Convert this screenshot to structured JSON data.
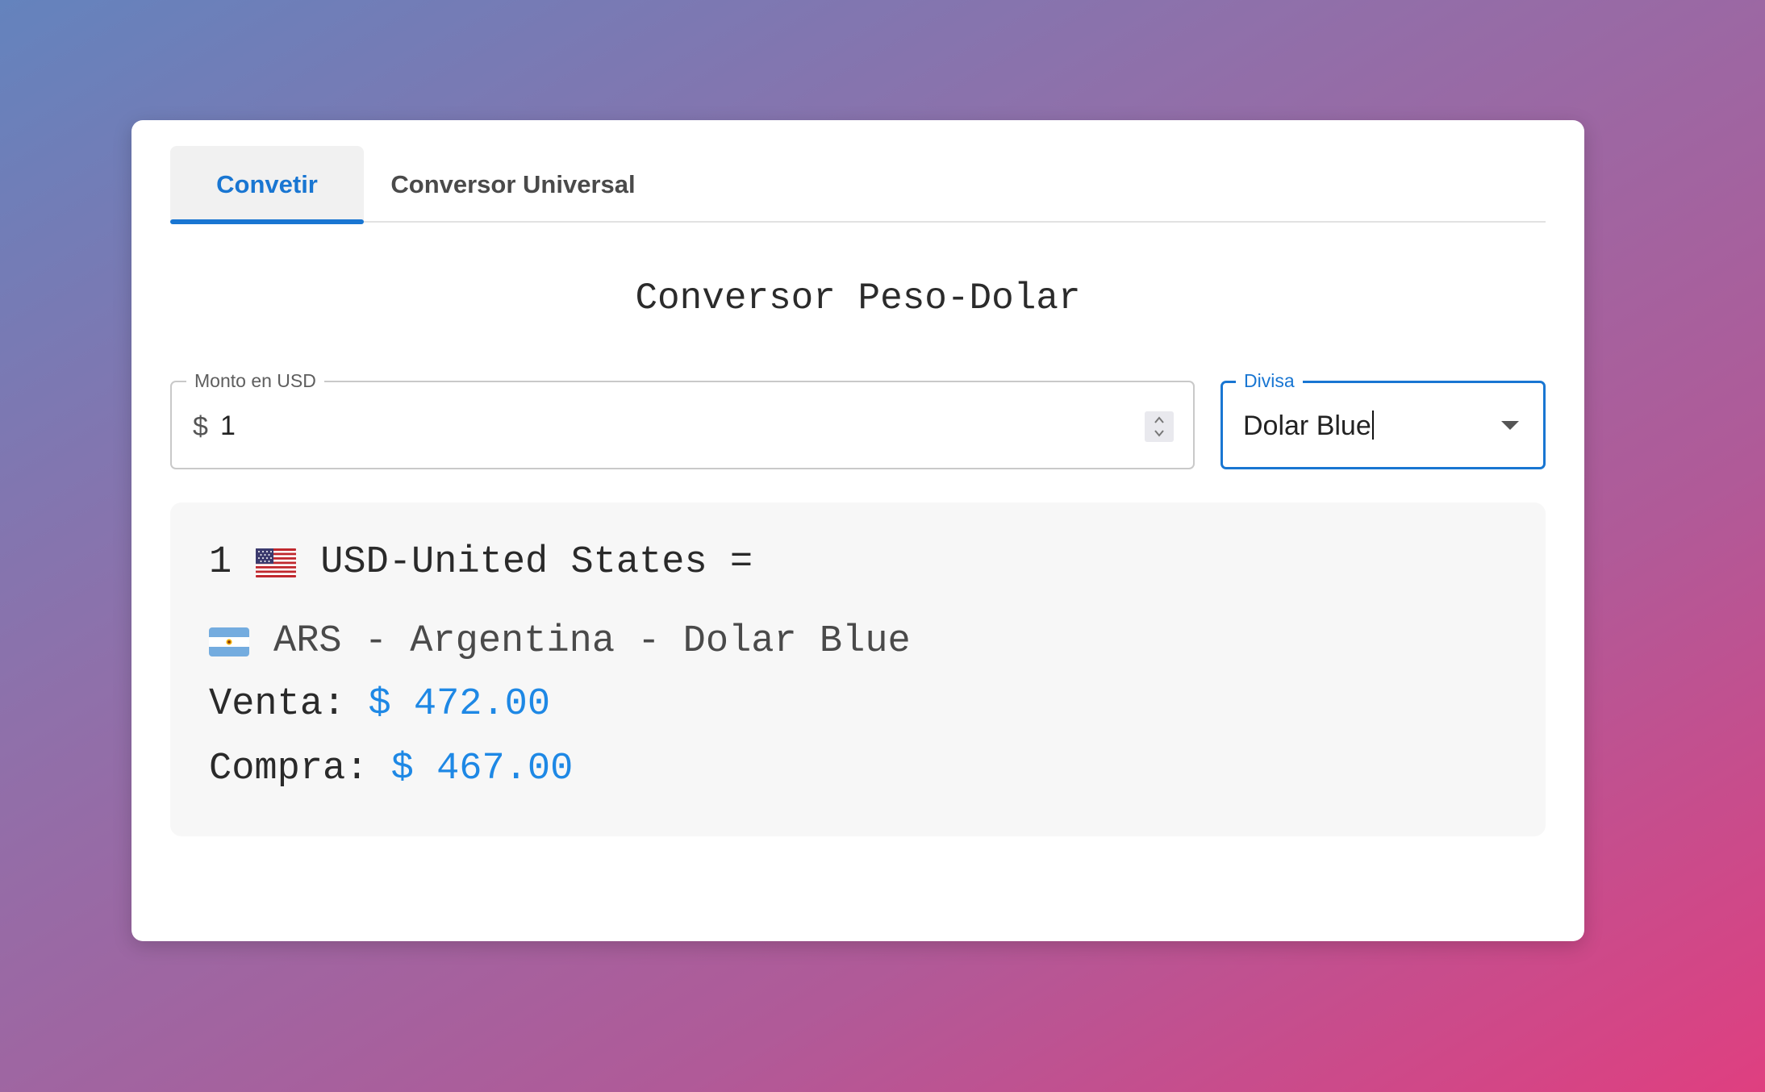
{
  "tabs": [
    {
      "label": "Convetir",
      "active": true
    },
    {
      "label": "Conversor Universal",
      "active": false
    }
  ],
  "title": "Conversor Peso-Dolar",
  "amount_field": {
    "label": "Monto en USD",
    "prefix": "$",
    "value": "1"
  },
  "currency_field": {
    "label": "Divisa",
    "value": "Dolar Blue"
  },
  "result": {
    "amount": "1",
    "from_currency": "USD-United States =",
    "to_currency": "ARS - Argentina - Dolar Blue",
    "sell_label": "Venta:",
    "sell_value": "$ 472.00",
    "buy_label": "Compra:",
    "buy_value": "$ 467.00",
    "from_flag_icon": "us-flag-icon",
    "to_flag_icon": "argentina-flag-icon"
  },
  "colors": {
    "accent": "#1976d2",
    "money": "#1e88e5"
  }
}
